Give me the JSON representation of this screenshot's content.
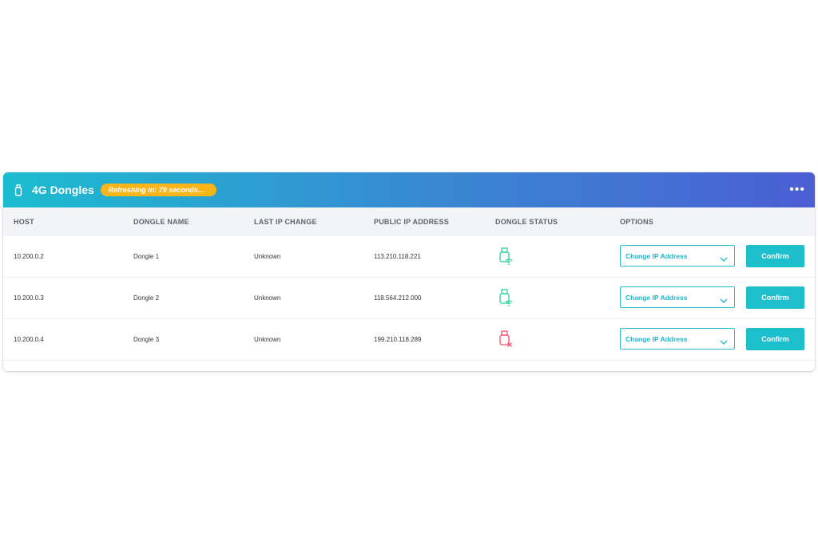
{
  "header": {
    "title": "4G Dongles",
    "refresh_badge": "Refreshing in: 79 seconds...",
    "more_menu": "•••",
    "gradient_start": "#1cbcd0",
    "gradient_end": "#4b5ed3",
    "badge_color": "#f7b51a"
  },
  "table": {
    "columns": [
      "HOST",
      "DONGLE NAME",
      "LAST IP CHANGE",
      "PUBLIC IP ADDRESS",
      "DONGLE STATUS",
      "OPTIONS"
    ],
    "rows": [
      {
        "host": "10.200.0.2",
        "name": "Dongle 1",
        "last_ip_change": "Unknown",
        "public_ip": "113.210.118.221",
        "status_icon": "usb-connected-icon",
        "status_color": "#2ed09a",
        "option_select": "Change IP Address",
        "confirm_label": "Confirm"
      },
      {
        "host": "10.200.0.3",
        "name": "Dongle 2",
        "last_ip_change": "Unknown",
        "public_ip": "118.564.212.000",
        "status_icon": "usb-connected-icon",
        "status_color": "#2ed09a",
        "option_select": "Change IP Address",
        "confirm_label": "Confirm"
      },
      {
        "host": "10.200.0.4",
        "name": "Dongle 3",
        "last_ip_change": "Unknown",
        "public_ip": "199.210.118.289",
        "status_icon": "usb-disconnected-icon",
        "status_color": "#f0506e",
        "option_select": "Change IP Address",
        "confirm_label": "Confirm"
      }
    ]
  },
  "colors": {
    "accent": "#1cbfcb",
    "connected": "#2ed09a",
    "disconnected": "#f0506e"
  }
}
